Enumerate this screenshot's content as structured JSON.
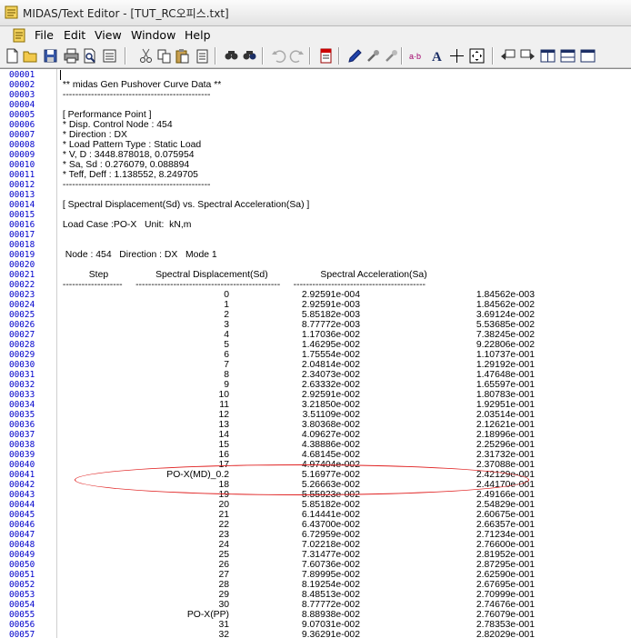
{
  "window": {
    "title": "MIDAS/Text Editor - [TUT_RC오피스.txt]"
  },
  "menu": [
    "File",
    "Edit",
    "View",
    "Window",
    "Help"
  ],
  "toolbar": [
    "new-file-icon",
    "open-folder-icon",
    "save-icon",
    "print-icon",
    "print-preview-icon",
    "page-setup-icon",
    "cut-icon",
    "copy-icon",
    "paste-icon",
    "clipboard-icon",
    "find-icon",
    "replace-icon",
    "undo-icon",
    "redo-icon",
    "bookmark-icon",
    "marker-icon",
    "tools-icon",
    "tools-alt-icon",
    "ab-icon",
    "font-icon",
    "cursor-cross-icon",
    "select-box-icon",
    "prev-window-icon",
    "next-window-icon",
    "tile-vertical-icon",
    "tile-horizontal-icon",
    "maximize-icon"
  ],
  "line_numbers": [
    "00001",
    "00002",
    "00003",
    "00004",
    "00005",
    "00006",
    "00007",
    "00008",
    "00009",
    "00010",
    "00011",
    "00012",
    "00013",
    "00014",
    "00015",
    "00016",
    "00017",
    "00018",
    "00019",
    "00020",
    "00021",
    "00022",
    "00023",
    "00024",
    "00025",
    "00026",
    "00027",
    "00028",
    "00029",
    "00030",
    "00031",
    "00032",
    "00033",
    "00034",
    "00035",
    "00036",
    "00037",
    "00038",
    "00039",
    "00040",
    "00041",
    "00042",
    "00043",
    "00044",
    "00045",
    "00046",
    "00047",
    "00048",
    "00049",
    "00050",
    "00051",
    "00052",
    "00053",
    "00054",
    "00055",
    "00056",
    "00057"
  ],
  "header_lines": [
    "",
    " ** midas Gen Pushover Curve Data **",
    " -----------------------------------------------",
    "",
    " [ Performance Point ]",
    " * Disp. Control Node : 454",
    " * Direction : DX",
    " * Load Pattern Type : Static Load",
    " * V, D : 3448.878018, 0.075954",
    " * Sa, Sd : 0.276079, 0.088894",
    " * Teff, Deff : 1.138552, 8.249705",
    " -----------------------------------------------",
    "",
    " [ Spectral Displacement(Sd) vs. Spectral Acceleration(Sa) ]",
    "",
    " Load Case :PO-X   Unit:  kN,m",
    "",
    "",
    "  Node : 454   Direction : DX   Mode 1",
    "",
    "           Step                  Spectral Displacement(Sd)                    Spectral Acceleration(Sa)",
    " -------------------     ----------------------------------------------     ------------------------------------------"
  ],
  "table_rows": [
    [
      "0",
      "2.92591e-004",
      "1.84562e-003"
    ],
    [
      "1",
      "2.92591e-003",
      "1.84562e-002"
    ],
    [
      "2",
      "5.85182e-003",
      "3.69124e-002"
    ],
    [
      "3",
      "8.77772e-003",
      "5.53685e-002"
    ],
    [
      "4",
      "1.17036e-002",
      "7.38245e-002"
    ],
    [
      "5",
      "1.46295e-002",
      "9.22806e-002"
    ],
    [
      "6",
      "1.75554e-002",
      "1.10737e-001"
    ],
    [
      "7",
      "2.04814e-002",
      "1.29192e-001"
    ],
    [
      "8",
      "2.34073e-002",
      "1.47648e-001"
    ],
    [
      "9",
      "2.63332e-002",
      "1.65597e-001"
    ],
    [
      "10",
      "2.92591e-002",
      "1.80783e-001"
    ],
    [
      "11",
      "3.21850e-002",
      "1.92951e-001"
    ],
    [
      "12",
      "3.51109e-002",
      "2.03514e-001"
    ],
    [
      "13",
      "3.80368e-002",
      "2.12621e-001"
    ],
    [
      "14",
      "4.09627e-002",
      "2.18996e-001"
    ],
    [
      "15",
      "4.38886e-002",
      "2.25296e-001"
    ],
    [
      "16",
      "4.68145e-002",
      "2.31732e-001"
    ],
    [
      "17",
      "4.97404e-002",
      "2.37088e-001"
    ],
    [
      "PO-X(MD)_0.2",
      "5.16977e-002",
      "2.42129e-001"
    ],
    [
      "18",
      "5.26663e-002",
      "2.44170e-001"
    ],
    [
      "19",
      "5.55923e-002",
      "2.49166e-001"
    ],
    [
      "20",
      "5.85182e-002",
      "2.54829e-001"
    ],
    [
      "21",
      "6.14441e-002",
      "2.60675e-001"
    ],
    [
      "22",
      "6.43700e-002",
      "2.66357e-001"
    ],
    [
      "23",
      "6.72959e-002",
      "2.71234e-001"
    ],
    [
      "24",
      "7.02218e-002",
      "2.76600e-001"
    ],
    [
      "25",
      "7.31477e-002",
      "2.81952e-001"
    ],
    [
      "26",
      "7.60736e-002",
      "2.87295e-001"
    ],
    [
      "27",
      "7.89995e-002",
      "2.62590e-001"
    ],
    [
      "28",
      "8.19254e-002",
      "2.67695e-001"
    ],
    [
      "29",
      "8.48513e-002",
      "2.70999e-001"
    ],
    [
      "30",
      "8.77772e-002",
      "2.74676e-001"
    ],
    [
      "PO-X(PP)",
      "8.88938e-002",
      "2.76079e-001"
    ],
    [
      "31",
      "9.07031e-002",
      "2.78353e-001"
    ],
    [
      "32",
      "9.36291e-002",
      "2.82029e-001"
    ]
  ]
}
